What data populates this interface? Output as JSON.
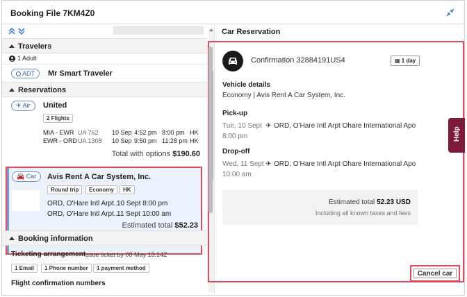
{
  "window": {
    "title": "Booking File 7KM4Z0"
  },
  "left": {
    "travelers": {
      "heading": "Travelers",
      "count": "1 Adult",
      "type_tag": "ADT",
      "name": "Mr Smart Traveler"
    },
    "reservations": {
      "heading": "Reservations",
      "air": {
        "tag": "Air",
        "title": "United",
        "chip": "2 Flights",
        "flights": [
          {
            "route": "MIA - EWR",
            "flight": "UA 762",
            "date": "10 Sep",
            "dep": "4:52 pm",
            "arr": "8:00 pm",
            "code": "HK"
          },
          {
            "route": "EWR - ORD",
            "flight": "UA 1308",
            "date": "10 Sep",
            "dep": "9:50 pm",
            "arr": "11:28 pm",
            "code": "HK"
          }
        ],
        "total_label": "Total with options",
        "total_value": "$190.60"
      },
      "car": {
        "tag": "Car",
        "title": "Avis Rent A Car System, Inc.",
        "chips": [
          "Round trip",
          "Economy",
          "HK"
        ],
        "rows": [
          {
            "place": "ORD, O'Hare Intl Arpt...",
            "when": "10 Sept 8:00 pm"
          },
          {
            "place": "ORD, O'Hare Intl Arpt...",
            "when": "11 Sept 10:00 am"
          }
        ],
        "total_label": "Estimated total",
        "total_value": "$52.23"
      }
    },
    "booking_info": {
      "heading": "Booking information",
      "ticketing_label": "Ticketing arrangement",
      "ticketing_value": "Issue ticket by 08 May 13:14Z",
      "chips": [
        "1 Email",
        "1 Phone number",
        "1 payment method"
      ],
      "flight_conf_label": "Flight confirmation numbers"
    }
  },
  "right": {
    "heading": "Car Reservation",
    "confirmation": "Confirmation 32884191US4",
    "duration": "1 day",
    "vehicle_heading": "Vehicle details",
    "vehicle_value": "Economy | Avis Rent A Car System, Inc.",
    "pickup_heading": "Pick-up",
    "pickup_date": "Tue, 10 Sept",
    "pickup_time": "8:00 pm",
    "pickup_place": "ORD, O'Hare Intl Arpt Ohare International Apo",
    "dropoff_heading": "Drop-off",
    "dropoff_date": "Wed, 11 Sept",
    "dropoff_time": "10:00 am",
    "dropoff_place": "ORD, O'Hare Intl Arpt Ohare International Apo",
    "total_label": "Estimated total",
    "total_value": "52.23 USD",
    "total_note": "Including all known taxes and fees",
    "cancel_label": "Cancel car"
  },
  "help_label": "Help",
  "colors": {
    "highlight": "#e14a5c",
    "help": "#7b1a3a",
    "tag": "#2f5ea8"
  }
}
